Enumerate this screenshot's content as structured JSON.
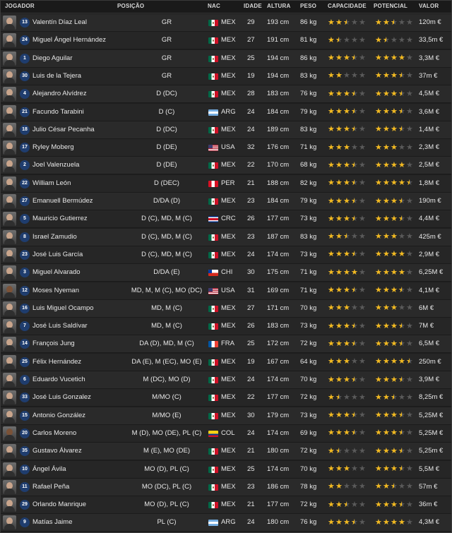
{
  "headers": {
    "player": "JOGADOR",
    "position": "POSIÇÃO",
    "nat": "NAC",
    "age": "IDADE",
    "height": "ALTURA",
    "weight": "PESO",
    "ability": "CAPACIDADE",
    "potential": "POTENCIAL",
    "value": "VALOR"
  },
  "colors": {
    "star_filled": "#f2b91f",
    "star_empty": "#5a5a5a",
    "number_badge": "#1f3d6e"
  },
  "players": [
    {
      "num": "13",
      "name": "Valentín Díaz Leal",
      "pos": "GR",
      "flag": "mex",
      "nat": "MEX",
      "age": "29",
      "height": "193 cm",
      "weight": "86 kg",
      "ca": 2.5,
      "pa": 2.5,
      "value": "120m €"
    },
    {
      "num": "24",
      "name": "Miguel Ángel Hernández",
      "pos": "GR",
      "flag": "mex",
      "nat": "MEX",
      "age": "27",
      "height": "191 cm",
      "weight": "81 kg",
      "ca": 1.5,
      "pa": 1.5,
      "value": "33,5m €"
    },
    {
      "num": "1",
      "name": "Diego Aguilar",
      "pos": "GR",
      "flag": "mex",
      "nat": "MEX",
      "age": "25",
      "height": "194 cm",
      "weight": "86 kg",
      "ca": 3.5,
      "pa": 4,
      "value": "3,3M €"
    },
    {
      "num": "30",
      "name": "Luis de la Tejera",
      "pos": "GR",
      "flag": "mex",
      "nat": "MEX",
      "age": "19",
      "height": "194 cm",
      "weight": "83 kg",
      "ca": 2,
      "pa": 3.5,
      "value": "37m €"
    },
    {
      "num": "4",
      "name": "Alejandro Alvídrez",
      "pos": "D (DC)",
      "flag": "mex",
      "nat": "MEX",
      "age": "28",
      "height": "183 cm",
      "weight": "76 kg",
      "ca": 3.5,
      "pa": 3.5,
      "value": "4,5M €"
    },
    {
      "num": "21",
      "name": "Facundo Tarabini",
      "pos": "D (C)",
      "flag": "arg",
      "nat": "ARG",
      "age": "24",
      "height": "184 cm",
      "weight": "79 kg",
      "ca": 3.5,
      "pa": 3.5,
      "value": "3,6M €"
    },
    {
      "num": "18",
      "name": "Julio César Pecanha",
      "pos": "D (DC)",
      "flag": "mex",
      "nat": "MEX",
      "age": "24",
      "height": "189 cm",
      "weight": "83 kg",
      "ca": 3.5,
      "pa": 3.5,
      "value": "1,4M €"
    },
    {
      "num": "17",
      "name": "Ryley Moberg",
      "pos": "D (DE)",
      "flag": "usa",
      "nat": "USA",
      "age": "32",
      "height": "176 cm",
      "weight": "71 kg",
      "ca": 3,
      "pa": 3,
      "value": "2,3M €"
    },
    {
      "num": "2",
      "name": "Joel Valenzuela",
      "pos": "D (DE)",
      "flag": "mex",
      "nat": "MEX",
      "age": "22",
      "height": "170 cm",
      "weight": "68 kg",
      "ca": 3.5,
      "pa": 4,
      "value": "2,5M €"
    },
    {
      "num": "22",
      "name": "William León",
      "pos": "D (DEC)",
      "flag": "per",
      "nat": "PER",
      "age": "21",
      "height": "188 cm",
      "weight": "82 kg",
      "ca": 3.5,
      "pa": 4.5,
      "value": "1,8M €"
    },
    {
      "num": "27",
      "name": "Emanuell Bermúdez",
      "pos": "D/DA (D)",
      "flag": "mex",
      "nat": "MEX",
      "age": "23",
      "height": "184 cm",
      "weight": "79 kg",
      "ca": 3.5,
      "pa": 3.5,
      "value": "190m €"
    },
    {
      "num": "5",
      "name": "Mauricio Gutierrez",
      "pos": "D (C), MD, M (C)",
      "flag": "crc",
      "nat": "CRC",
      "age": "26",
      "height": "177 cm",
      "weight": "73 kg",
      "ca": 3.5,
      "pa": 3.5,
      "value": "4,4M €"
    },
    {
      "num": "8",
      "name": "Israel Zamudio",
      "pos": "D (C), MD, M (C)",
      "flag": "mex",
      "nat": "MEX",
      "age": "23",
      "height": "187 cm",
      "weight": "83 kg",
      "ca": 2.5,
      "pa": 3,
      "value": "425m €"
    },
    {
      "num": "23",
      "name": "José Luis García",
      "pos": "D (C), MD, M (C)",
      "flag": "mex",
      "nat": "MEX",
      "age": "24",
      "height": "174 cm",
      "weight": "73 kg",
      "ca": 3.5,
      "pa": 4,
      "value": "2,9M €"
    },
    {
      "num": "3",
      "name": "Miguel Alvarado",
      "pos": "D/DA (E)",
      "flag": "chi",
      "nat": "CHI",
      "age": "30",
      "height": "175 cm",
      "weight": "71 kg",
      "ca": 4,
      "pa": 4,
      "value": "6,25M €"
    },
    {
      "num": "12",
      "name": "Moses Nyeman",
      "pos": "MD, M, M (C), MO (DC)",
      "flag": "usa",
      "nat": "USA",
      "age": "31",
      "height": "169 cm",
      "weight": "71 kg",
      "ca": 3.5,
      "pa": 3.5,
      "value": "4,1M €",
      "dark": true
    },
    {
      "num": "16",
      "name": "Luis Miguel Ocampo",
      "pos": "MD, M (C)",
      "flag": "mex",
      "nat": "MEX",
      "age": "27",
      "height": "171 cm",
      "weight": "70 kg",
      "ca": 3,
      "pa": 3,
      "value": "6M €"
    },
    {
      "num": "7",
      "name": "José Luis Saldívar",
      "pos": "MD, M (C)",
      "flag": "mex",
      "nat": "MEX",
      "age": "26",
      "height": "183 cm",
      "weight": "73 kg",
      "ca": 3.5,
      "pa": 3.5,
      "value": "7M €"
    },
    {
      "num": "14",
      "name": "François Jung",
      "pos": "DA (D), MD, M (C)",
      "flag": "fra",
      "nat": "FRA",
      "age": "25",
      "height": "172 cm",
      "weight": "72 kg",
      "ca": 3.5,
      "pa": 3.5,
      "value": "6,5M €"
    },
    {
      "num": "25",
      "name": "Félix Hernández",
      "pos": "DA (E), M (EC), MO (E)",
      "flag": "mex",
      "nat": "MEX",
      "age": "19",
      "height": "167 cm",
      "weight": "64 kg",
      "ca": 3,
      "pa": 4.5,
      "value": "250m €"
    },
    {
      "num": "6",
      "name": "Eduardo Vucetich",
      "pos": "M (DC), MO (D)",
      "flag": "mex",
      "nat": "MEX",
      "age": "24",
      "height": "174 cm",
      "weight": "70 kg",
      "ca": 3.5,
      "pa": 3.5,
      "value": "3,9M €"
    },
    {
      "num": "33",
      "name": "José Luis Gonzalez",
      "pos": "M/MO (C)",
      "flag": "mex",
      "nat": "MEX",
      "age": "22",
      "height": "177 cm",
      "weight": "72 kg",
      "ca": 1.5,
      "pa": 2.5,
      "value": "8,25m €"
    },
    {
      "num": "15",
      "name": "Antonio González",
      "pos": "M/MO (E)",
      "flag": "mex",
      "nat": "MEX",
      "age": "30",
      "height": "179 cm",
      "weight": "73 kg",
      "ca": 3.5,
      "pa": 3.5,
      "value": "5,25M €"
    },
    {
      "num": "20",
      "name": "Carlos Moreno",
      "pos": "M (D), MO (DE), PL (C)",
      "flag": "col",
      "nat": "COL",
      "age": "24",
      "height": "174 cm",
      "weight": "69 kg",
      "ca": 3.5,
      "pa": 3.5,
      "value": "5,25M €",
      "dark": true
    },
    {
      "num": "35",
      "name": "Gustavo Álvarez",
      "pos": "M (E), MO (DE)",
      "flag": "mex",
      "nat": "MEX",
      "age": "21",
      "height": "180 cm",
      "weight": "72 kg",
      "ca": 1.5,
      "pa": 3.5,
      "value": "5,25m €"
    },
    {
      "num": "10",
      "name": "Ángel Ávila",
      "pos": "MO (D), PL (C)",
      "flag": "mex",
      "nat": "MEX",
      "age": "25",
      "height": "174 cm",
      "weight": "70 kg",
      "ca": 3,
      "pa": 3.5,
      "value": "5,5M €"
    },
    {
      "num": "11",
      "name": "Rafael Peña",
      "pos": "MO (DC), PL (C)",
      "flag": "mex",
      "nat": "MEX",
      "age": "23",
      "height": "186 cm",
      "weight": "78 kg",
      "ca": 2,
      "pa": 2.5,
      "value": "57m €"
    },
    {
      "num": "29",
      "name": "Orlando Manrique",
      "pos": "MO (D), PL (C)",
      "flag": "mex",
      "nat": "MEX",
      "age": "21",
      "height": "177 cm",
      "weight": "72 kg",
      "ca": 2.5,
      "pa": 3.5,
      "value": "36m €"
    },
    {
      "num": "9",
      "name": "Matías Jaime",
      "pos": "PL (C)",
      "flag": "arg",
      "nat": "ARG",
      "age": "24",
      "height": "180 cm",
      "weight": "76 kg",
      "ca": 3.5,
      "pa": 4,
      "value": "4,3M €"
    }
  ]
}
